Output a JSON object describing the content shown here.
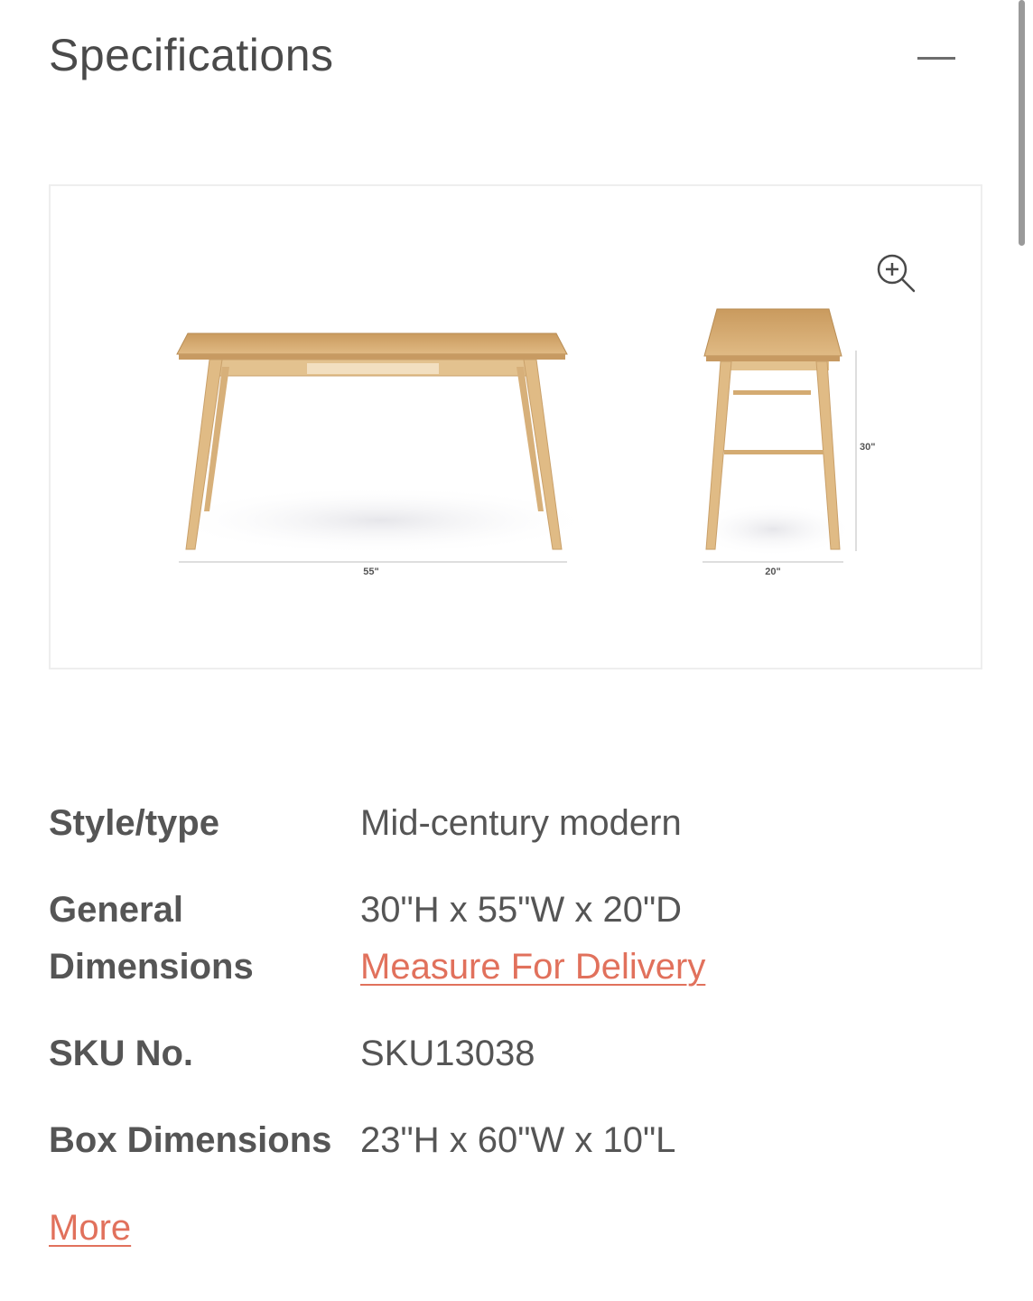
{
  "section": {
    "title": "Specifications"
  },
  "product_image": {
    "width_label": "55\"",
    "depth_label": "20\"",
    "height_label": "30\""
  },
  "specs": [
    {
      "label": "Style/type",
      "value": "Mid-century modern"
    },
    {
      "label": "General Dimensions",
      "value": "30\"H x 55\"W x 20\"D",
      "link": "Measure For Delivery"
    },
    {
      "label": "SKU No.",
      "value": "SKU13038"
    },
    {
      "label": "Box Dimensions",
      "value": "23\"H x 60\"W x 10\"L"
    }
  ],
  "more_label": "More",
  "colors": {
    "accent": "#e1715c",
    "text": "#555555",
    "wood": "#d6b07a"
  },
  "icons": {
    "collapse": "minus-icon",
    "zoom": "zoom-in-icon"
  }
}
